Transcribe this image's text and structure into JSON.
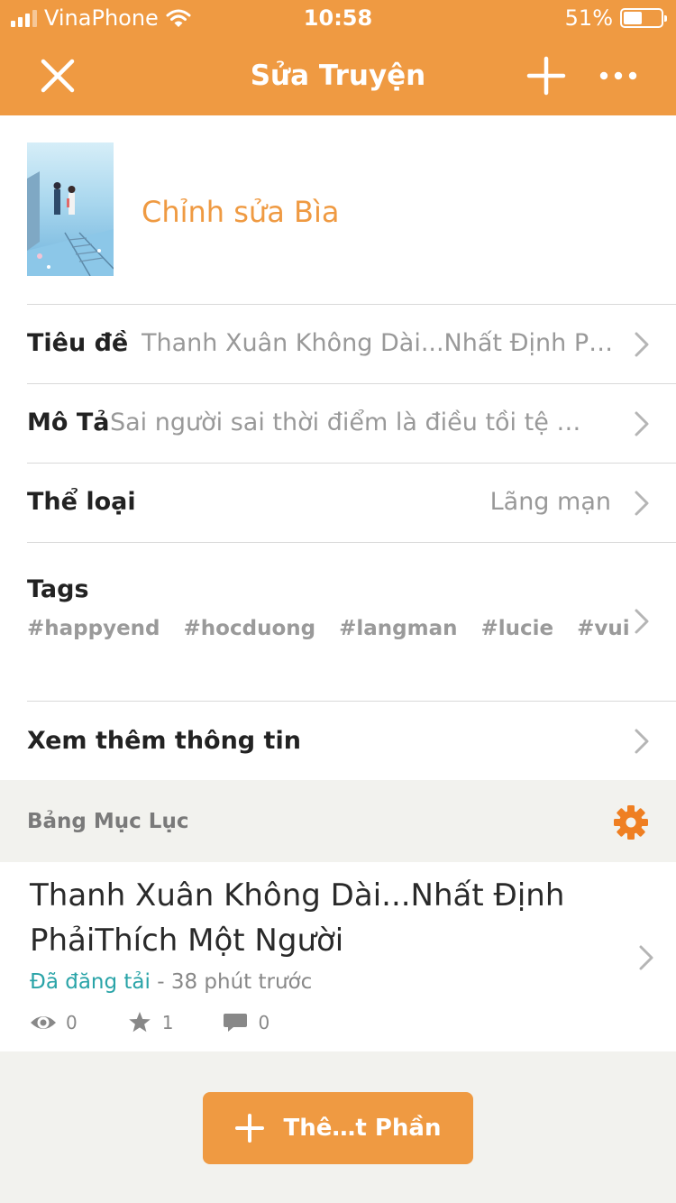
{
  "status_bar": {
    "carrier": "VinaPhone",
    "time": "10:58",
    "battery": "51%",
    "battery_level": 0.51
  },
  "nav": {
    "title": "Sửa Truyện"
  },
  "cover": {
    "edit_label": "Chỉnh sửa Bìa"
  },
  "fields": {
    "title": {
      "label": "Tiêu đề",
      "value": "Thanh Xuân Không Dài...Nhất Định Phải Thích Một Người"
    },
    "description": {
      "label": "Mô Tả",
      "value": "Sai người sai thời điểm là điều tồi tệ nhất"
    },
    "genre": {
      "label": "Thể loại",
      "value": "Lãng mạn"
    },
    "tags": {
      "label": "Tags",
      "items": [
        "#happyend",
        "#hocduong",
        "#langman",
        "#lucie",
        "#vui"
      ]
    },
    "more_info": {
      "label": "Xem thêm thông tin"
    }
  },
  "toc": {
    "title": "Bảng Mục Lục"
  },
  "parts": [
    {
      "title": "Thanh Xuân Không Dài...Nhất Định PhảiThích Một Người",
      "status": "Đã đăng tải",
      "time": "- 38 phút trước",
      "views": "0",
      "votes": "1",
      "comments": "0"
    }
  ],
  "add_part_label": "Thê…t Phần",
  "colors": {
    "accent": "#ef9a42",
    "published": "#2aa4a8"
  }
}
